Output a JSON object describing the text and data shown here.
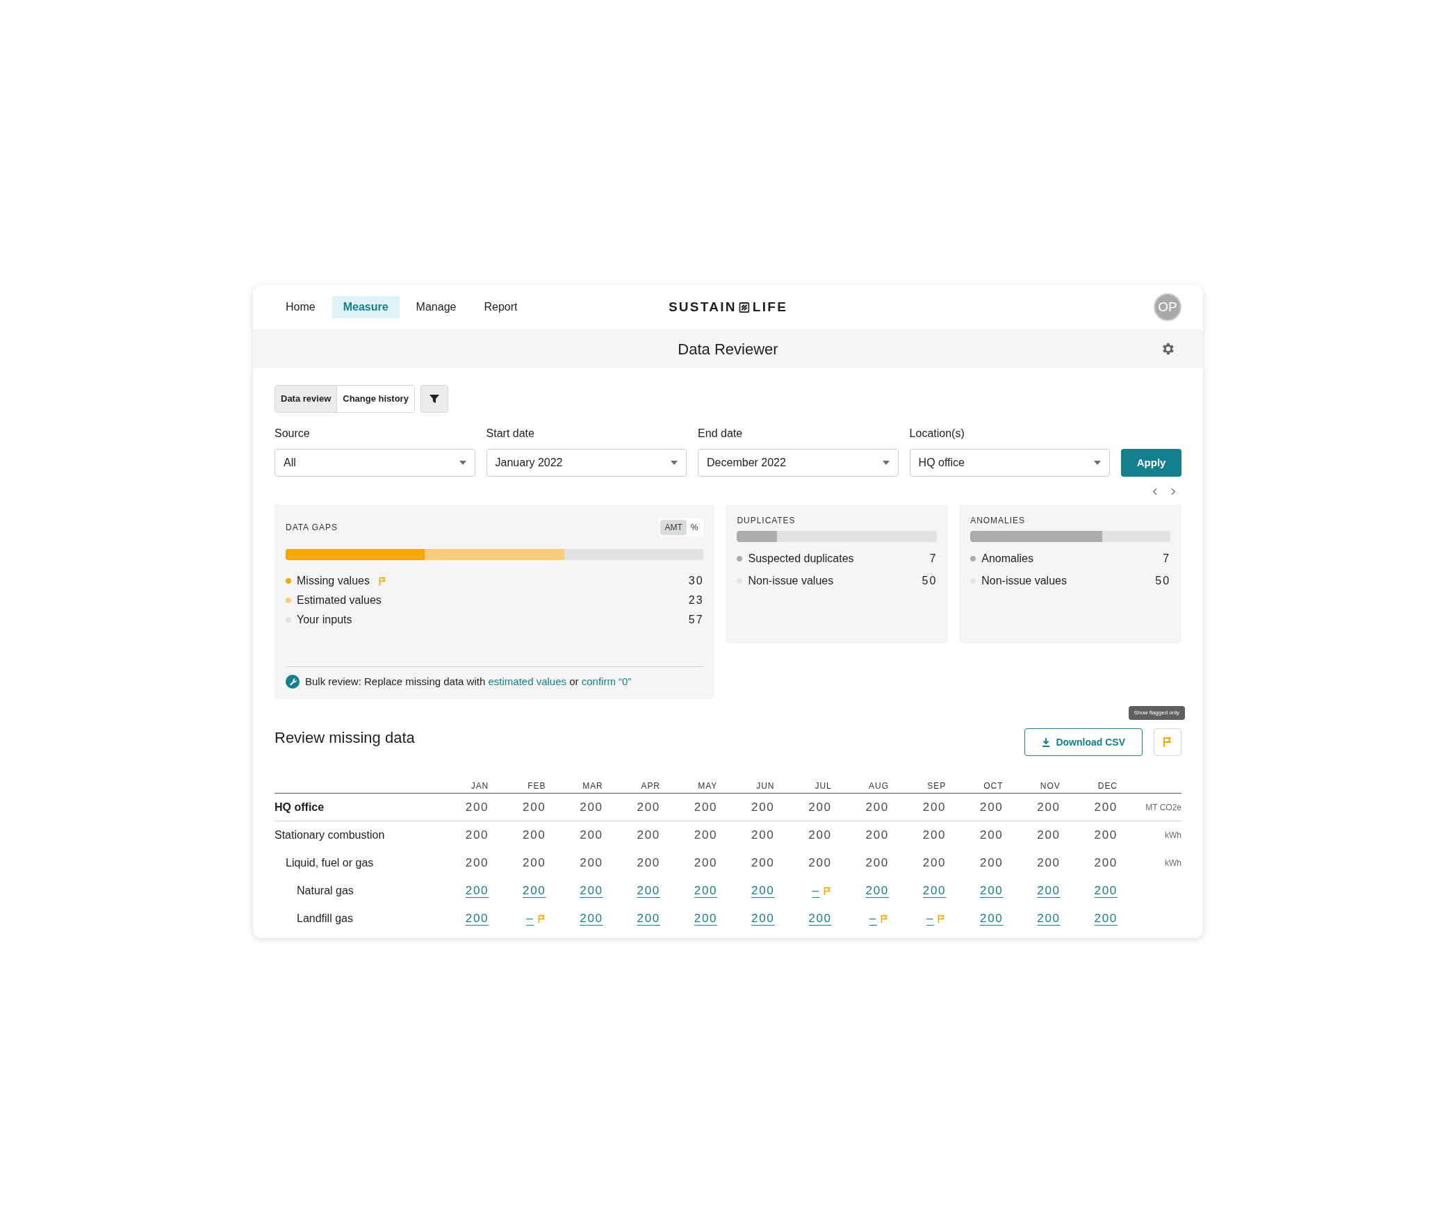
{
  "nav": {
    "items": [
      {
        "label": "Home",
        "selected": false
      },
      {
        "label": "Measure",
        "selected": true
      },
      {
        "label": "Manage",
        "selected": false
      },
      {
        "label": "Report",
        "selected": false
      }
    ],
    "logo": {
      "left": "SUSTAIN",
      "right": "LIFE"
    },
    "avatar": "OP"
  },
  "header": {
    "title": "Data Reviewer"
  },
  "view_tabs": [
    {
      "label": "Data review",
      "selected": true
    },
    {
      "label": "Change history",
      "selected": false
    }
  ],
  "filters": [
    {
      "label": "Source",
      "value": "All"
    },
    {
      "label": "Start date",
      "value": "January 2022"
    },
    {
      "label": "End date",
      "value": "December 2022"
    },
    {
      "label": "Location(s)",
      "value": "HQ office"
    }
  ],
  "apply_button": "Apply",
  "data_gaps": {
    "title": "DATA GAPS",
    "toggle": [
      {
        "label": "AMT",
        "selected": true
      },
      {
        "label": "%",
        "selected": false
      }
    ],
    "legend": [
      {
        "label": "Missing values",
        "value": "30",
        "color": "#f5a800",
        "level": 0.333,
        "flagged": true
      },
      {
        "label": "Estimated values",
        "value": "23",
        "color": "#f9cd7c",
        "level": 0.667,
        "flagged": false
      },
      {
        "label": "Your inputs",
        "value": "57",
        "color": "#e1e3e3",
        "flagged": false
      }
    ],
    "bulk_review": {
      "text_before": "Bulk review: Replace missing data with ",
      "link_1": "estimated values",
      "text_middle": " or ",
      "link_2": "confirm “0”"
    }
  },
  "side_cards": [
    {
      "title": "DUPLICATES",
      "level": 0.2,
      "legend": [
        {
          "label": "Suspected duplicates",
          "value": "7",
          "color": "#adadad"
        },
        {
          "label": "Non-issue values",
          "value": "50",
          "color": "#e3e3e3"
        }
      ]
    },
    {
      "title": "ANOMALIES",
      "level": 0.66,
      "legend": [
        {
          "label": "Anomalies",
          "value": "7",
          "color": "#adadad"
        },
        {
          "label": "Non-issue values",
          "value": "50",
          "color": "#e3e3e3"
        }
      ]
    }
  ],
  "review": {
    "title": "Review missing data",
    "download_button": "Download CSV",
    "tooltip": "Show flagged only",
    "columns": [
      "JAN",
      "FEB",
      "MAR",
      "APR",
      "MAY",
      "JUN",
      "JUL",
      "AUG",
      "SEP",
      "OCT",
      "NOV",
      "DEC"
    ],
    "rows": [
      {
        "label": "HQ office",
        "kind": "total",
        "unit": "MT CO2e",
        "cells": [
          {
            "value": "200",
            "flagged": false
          },
          {
            "value": "200",
            "flagged": false
          },
          {
            "value": "200",
            "flagged": false
          },
          {
            "value": "200",
            "flagged": false
          },
          {
            "value": "200",
            "flagged": false
          },
          {
            "value": "200",
            "flagged": false
          },
          {
            "value": "200",
            "flagged": false
          },
          {
            "value": "200",
            "flagged": false
          },
          {
            "value": "200",
            "flagged": false
          },
          {
            "value": "200",
            "flagged": false
          },
          {
            "value": "200",
            "flagged": false
          },
          {
            "value": "200",
            "flagged": false
          }
        ],
        "children": [
          {
            "label": "Stationary combustion",
            "kind": "group",
            "unit": "kWh",
            "cells": [
              {
                "value": "200",
                "flagged": false
              },
              {
                "value": "200",
                "flagged": false
              },
              {
                "value": "200",
                "flagged": false
              },
              {
                "value": "200",
                "flagged": false
              },
              {
                "value": "200",
                "flagged": false
              },
              {
                "value": "200",
                "flagged": false
              },
              {
                "value": "200",
                "flagged": false
              },
              {
                "value": "200",
                "flagged": false
              },
              {
                "value": "200",
                "flagged": false
              },
              {
                "value": "200",
                "flagged": false
              },
              {
                "value": "200",
                "flagged": false
              },
              {
                "value": "200",
                "flagged": false
              }
            ],
            "children": [
              {
                "label": "Liquid, fuel or gas",
                "kind": "group",
                "unit": "kWh",
                "cells": [
                  {
                    "value": "200",
                    "flagged": false
                  },
                  {
                    "value": "200",
                    "flagged": false
                  },
                  {
                    "value": "200",
                    "flagged": false
                  },
                  {
                    "value": "200",
                    "flagged": false
                  },
                  {
                    "value": "200",
                    "flagged": false
                  },
                  {
                    "value": "200",
                    "flagged": false
                  },
                  {
                    "value": "200",
                    "flagged": false
                  },
                  {
                    "value": "200",
                    "flagged": false
                  },
                  {
                    "value": "200",
                    "flagged": false
                  },
                  {
                    "value": "200",
                    "flagged": false
                  },
                  {
                    "value": "200",
                    "flagged": false
                  },
                  {
                    "value": "200",
                    "flagged": false
                  }
                ],
                "children": [
                  {
                    "label": "Natural gas",
                    "kind": "source",
                    "cells": [
                      {
                        "value": "200",
                        "flagged": false
                      },
                      {
                        "value": "200",
                        "flagged": false
                      },
                      {
                        "value": "200",
                        "flagged": false
                      },
                      {
                        "value": "200",
                        "flagged": false
                      },
                      {
                        "value": "200",
                        "flagged": false
                      },
                      {
                        "value": "200",
                        "flagged": false
                      },
                      {
                        "value": "–",
                        "flagged": true
                      },
                      {
                        "value": "200",
                        "flagged": false
                      },
                      {
                        "value": "200",
                        "flagged": false
                      },
                      {
                        "value": "200",
                        "flagged": false
                      },
                      {
                        "value": "200",
                        "flagged": false
                      },
                      {
                        "value": "200",
                        "flagged": false
                      }
                    ]
                  },
                  {
                    "label": "Landfill gas",
                    "kind": "source",
                    "cells": [
                      {
                        "value": "200",
                        "flagged": false
                      },
                      {
                        "value": "–",
                        "flagged": true
                      },
                      {
                        "value": "200",
                        "flagged": false
                      },
                      {
                        "value": "200",
                        "flagged": false
                      },
                      {
                        "value": "200",
                        "flagged": false
                      },
                      {
                        "value": "200",
                        "flagged": false
                      },
                      {
                        "value": "200",
                        "flagged": false
                      },
                      {
                        "value": "–",
                        "flagged": true
                      },
                      {
                        "value": "–",
                        "flagged": true
                      },
                      {
                        "value": "200",
                        "flagged": false
                      },
                      {
                        "value": "200",
                        "flagged": false
                      },
                      {
                        "value": "200",
                        "flagged": false
                      }
                    ]
                  }
                ]
              }
            ]
          }
        ]
      }
    ]
  }
}
